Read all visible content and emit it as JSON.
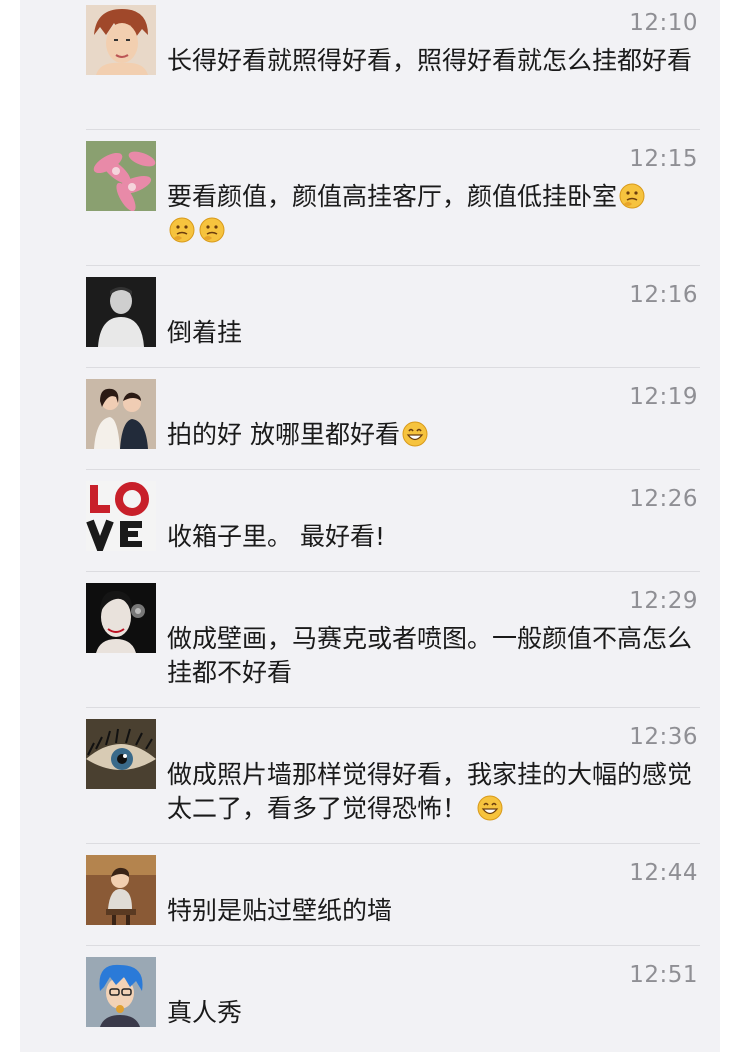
{
  "comments": [
    {
      "avatar": "anime-boy-avatar",
      "time": "12:10",
      "text": "长得好看就照得好看，照得好看就怎么挂都好看",
      "emoji": []
    },
    {
      "avatar": "lily-flower-avatar",
      "time": "12:15",
      "text": "要看颜值，颜值高挂客厅，颜值低挂卧室",
      "emoji": [
        "thinking-emoji",
        "thinking-emoji",
        "thinking-emoji"
      ]
    },
    {
      "avatar": "man-portrait-avatar",
      "time": "12:16",
      "text": "倒着挂",
      "emoji": []
    },
    {
      "avatar": "couple-photo-avatar",
      "time": "12:19",
      "text": "拍的好 放哪里都好看",
      "emoji": [
        "grinning-emoji"
      ]
    },
    {
      "avatar": "love-letters-avatar",
      "time": "12:26",
      "text": "收箱子里。 最好看!",
      "emoji": []
    },
    {
      "avatar": "woman-mask-avatar",
      "time": "12:29",
      "text": "做成壁画，马赛克或者喷图。一般颜值不高怎么挂都不好看",
      "emoji": []
    },
    {
      "avatar": "eye-closeup-avatar",
      "time": "12:36",
      "text": "做成照片墙那样觉得好看，我家挂的大幅的感觉太二了，看多了觉得恐怖！",
      "emoji": [
        "grinning-emoji"
      ]
    },
    {
      "avatar": "child-photo-avatar",
      "time": "12:44",
      "text": "特别是贴过壁纸的墙",
      "emoji": []
    },
    {
      "avatar": "blue-hair-avatar",
      "time": "12:51",
      "text": "真人秀",
      "emoji": []
    }
  ]
}
